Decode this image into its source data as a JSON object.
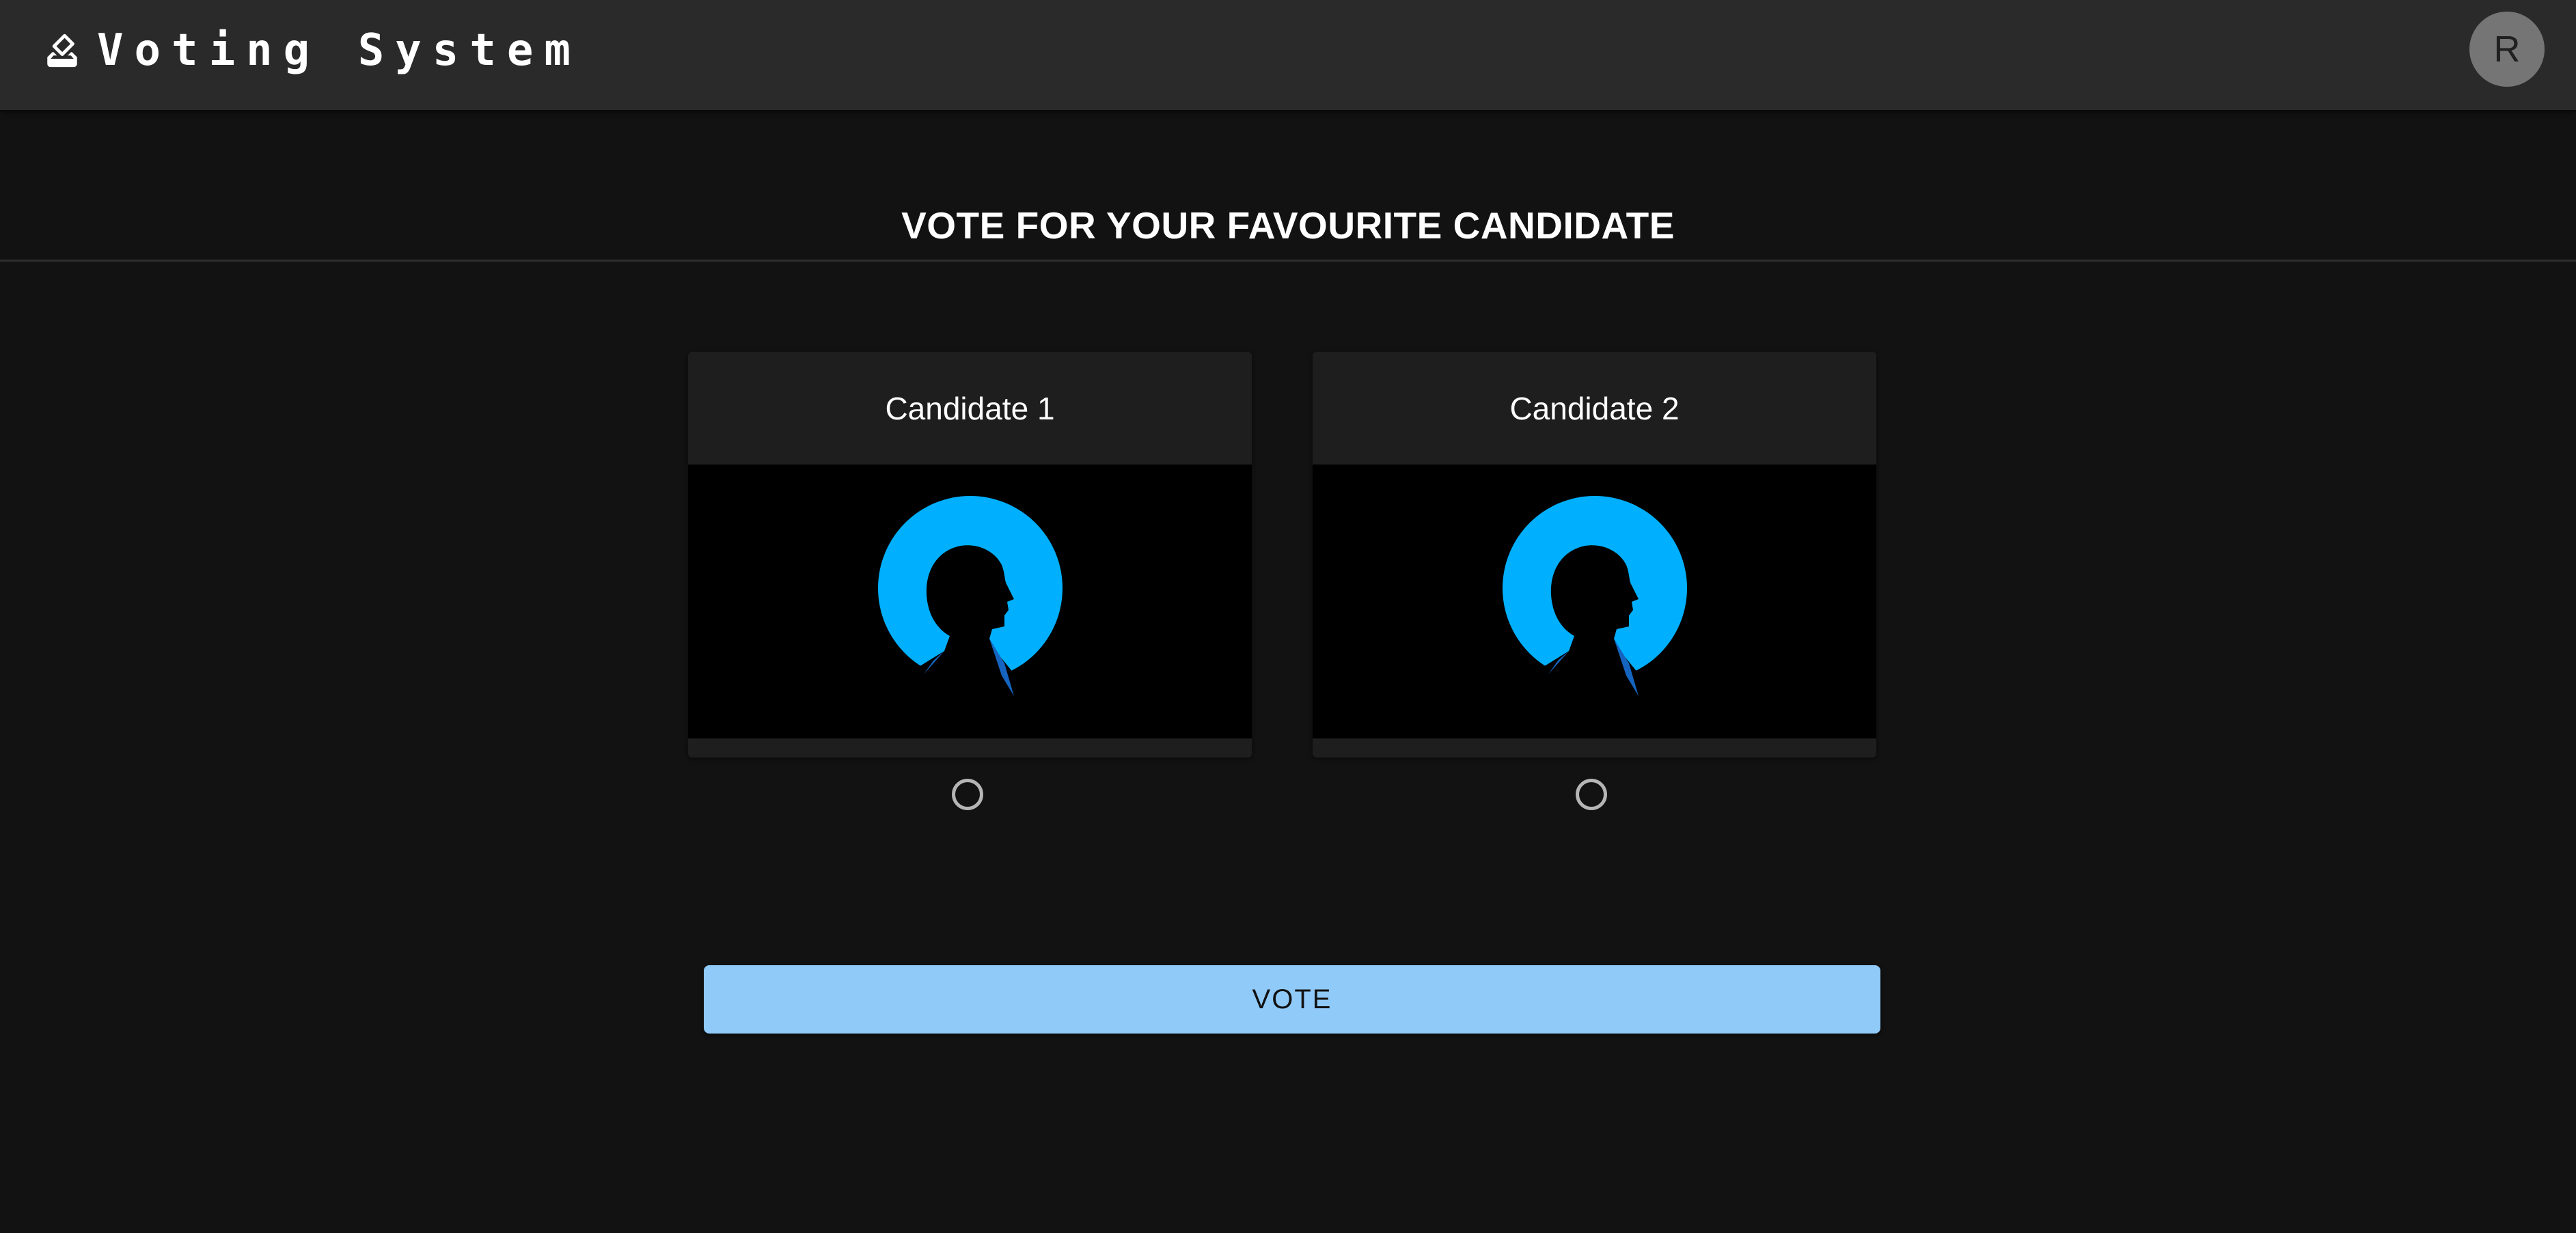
{
  "appbar": {
    "title": "Voting System",
    "brand_icon": "ballot-box-icon",
    "avatar_initial": "R"
  },
  "main": {
    "heading": "VOTE FOR YOUR FAVOURITE CANDIDATE",
    "candidates": [
      {
        "name": "Candidate 1",
        "image": "person-silhouette-icon",
        "selected": false
      },
      {
        "name": "Candidate 2",
        "image": "person-silhouette-icon",
        "selected": false
      }
    ],
    "vote_label": "VOTE"
  },
  "colors": {
    "background": "#121212",
    "appbar": "#2a2a2a",
    "card": "#1e1e1e",
    "accent_button": "#90caf9",
    "silhouette_circle": "#00b0ff"
  }
}
